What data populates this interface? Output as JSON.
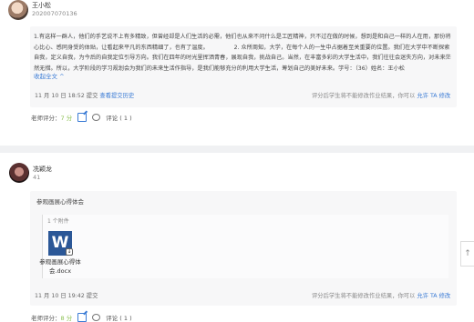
{
  "post1": {
    "name": "王小松",
    "student_id": "202007070136",
    "content": "1.有这样一群人，他们的手艺说不上有多精致，但曾经却是人们生活的必需，他们也从来不问什么是工匠精神，只不过在做的时候，想到是和自己一样的人在用，那份将心比心、感同身受的体贴，让看起来平凡的东西精细了，也有了温度。　　　　　2. 众所周知，大学，在每个人的一生中占据着至关重要的位置。我们在大学中不断探索自我，定义自我，为今后的自我定位引导方向。我们在四年的时光里挥洒青春，展现自我，挑战自己。当然，在丰富多彩的大学生活中，我们往往会迷失方向，对未来茫然无措。所以，大学阶段的学习规划会为我们的未来生活作指导，是我们能够充分的利用大学生活，筹划自己的美好未来。学号：（36）姓名：王小松",
    "collapse_label": "收起全文 ^",
    "submit_time": "11 月 10 日 18:52 提交",
    "view_history": "查看提交历史",
    "note": "评分后学生将不能修改作业结果，你可以",
    "allow_edit": "允许 TA 修改",
    "score_label": "老师评分：",
    "score_value": "7 分",
    "comment_label": "评论 ( 1 )"
  },
  "post2": {
    "name": "冼颖龙",
    "student_id": "41",
    "doc_title": "参观画展心得体会",
    "attach_count": "1 个附件",
    "word_letter": "W",
    "file_name": "参观画展心得体会.docx",
    "submit_time": "11 月 10 日 19:42 提交",
    "note": "评分后学生将不能修改作业结果，你可以",
    "allow_edit": "允许 TA 修改",
    "score_label": "老师评分：",
    "score_value": "8 分",
    "comment_label": "评论 ( 1 )"
  },
  "scroll_top_icon": "arrow-up-icon"
}
